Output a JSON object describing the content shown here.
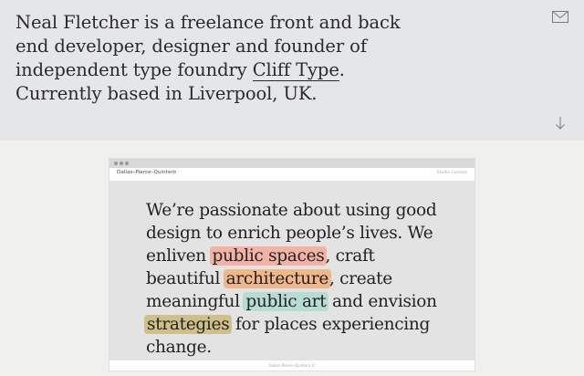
{
  "intro": {
    "text_before": "Neal Fletcher is a freelance front and back end developer, designer and founder of independent type foundry ",
    "link_text": "Cliff Type",
    "text_after": ". Currently based in Liverpool, UK."
  },
  "icons": {
    "mail": "mail-icon",
    "scroll_down": "arrow-down-icon"
  },
  "project_preview": {
    "site_name": "Dallas–Pierce–Quintero",
    "nav_text": "Studio  Contact",
    "statement": {
      "t1": "We’re passionate about using good design to enrich people’s lives. We enliven ",
      "h1": "public spaces",
      "t2": ", craft beautiful ",
      "h2": "architecture",
      "t3": ", create meaningful ",
      "h3": "public art",
      "t4": " and envision ",
      "h4": "strategies",
      "t5": " for places experiencing change."
    },
    "footer_text": "Dallas–Pierce–Quintero ©",
    "highlight_colors": {
      "public_spaces": "#f2b3a6",
      "architecture": "#f0b88a",
      "public_art": "#b8dcd2",
      "strategies": "#cfc08a"
    }
  }
}
